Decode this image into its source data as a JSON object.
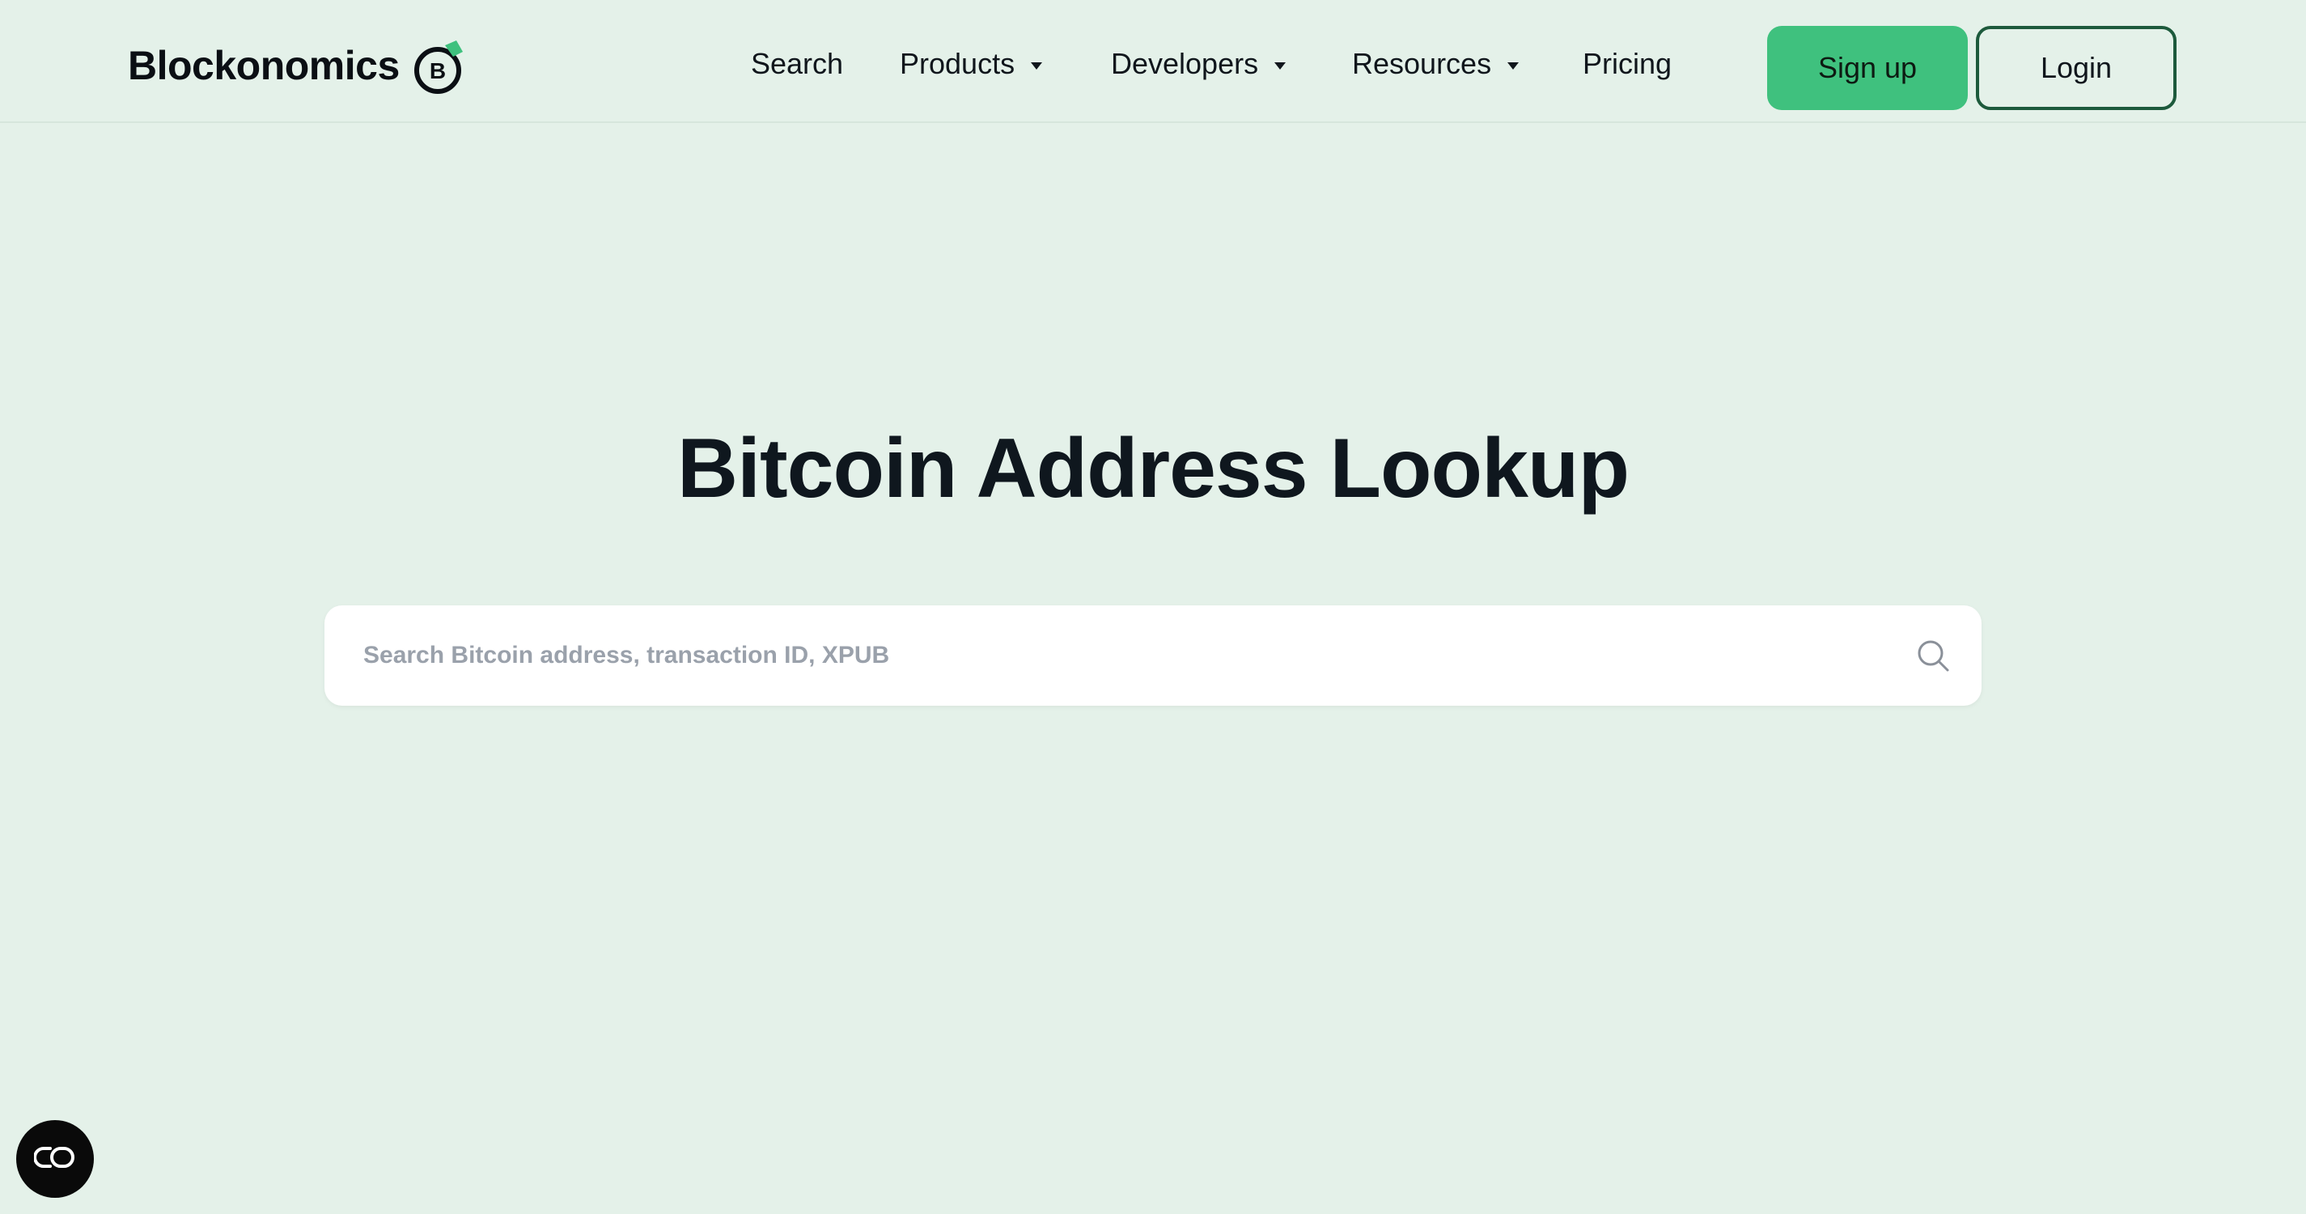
{
  "brand": {
    "name": "Blockonomics",
    "mark_letter": "B",
    "accent_color": "#3fc17e"
  },
  "nav": {
    "items": [
      {
        "label": "Search",
        "has_dropdown": false
      },
      {
        "label": "Products",
        "has_dropdown": true
      },
      {
        "label": "Developers",
        "has_dropdown": true
      },
      {
        "label": "Resources",
        "has_dropdown": true
      },
      {
        "label": "Pricing",
        "has_dropdown": false
      }
    ],
    "signup_label": "Sign up",
    "login_label": "Login"
  },
  "hero": {
    "title": "Bitcoin Address Lookup"
  },
  "search": {
    "placeholder": "Search Bitcoin address, transaction ID, XPUB",
    "value": "",
    "icon": "search-icon"
  },
  "widget": {
    "icon": "chat-widget-icon"
  },
  "colors": {
    "background": "#e4f1e9",
    "signup_bg": "#3fc17e",
    "login_border": "#1d5a3c"
  }
}
